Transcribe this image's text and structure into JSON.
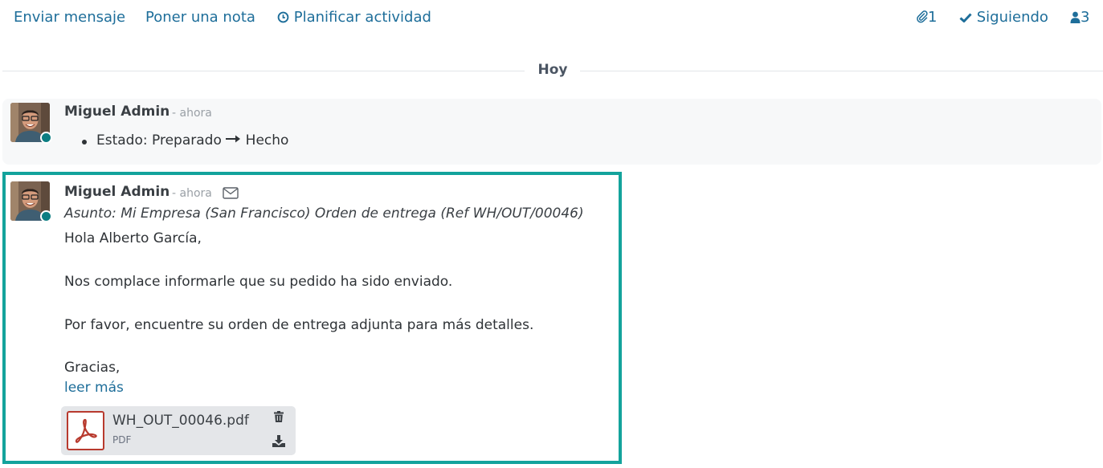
{
  "toolbar": {
    "send_message": "Enviar mensaje",
    "log_note": "Poner una nota",
    "schedule_activity": "Planificar actividad",
    "attachments_count": "1",
    "following": "Siguiendo",
    "followers_count": "3"
  },
  "separator": {
    "label": "Hoy"
  },
  "messages": [
    {
      "author": "Miguel Admin",
      "time": "- ahora",
      "tracking": {
        "field": "Estado:",
        "old": "Preparado",
        "new": "Hecho"
      }
    },
    {
      "author": "Miguel Admin",
      "time": "- ahora",
      "subject": "Asunto: Mi Empresa (San Francisco) Orden de entrega (Ref WH/OUT/00046)",
      "body": [
        "Hola Alberto García,",
        "Nos complace informarle que su pedido ha sido enviado.",
        "Por favor, encuentre su orden de entrega adjunta para más detalles.",
        "Gracias,"
      ],
      "read_more": "leer más",
      "attachment": {
        "name": "WH_OUT_00046.pdf",
        "type": "PDF"
      }
    }
  ],
  "icons": {
    "clock": "clock-icon",
    "paperclip": "paperclip-icon",
    "check": "check-icon",
    "user": "user-icon",
    "envelope": "envelope-icon",
    "arrow": "arrow-right-icon",
    "pdf": "pdf-icon",
    "trash": "trash-icon",
    "download": "download-icon"
  },
  "colors": {
    "link": "#1e6e9a",
    "highlight_border": "#13a39c",
    "online_status": "#0b7d82",
    "pdf_red": "#b83a2e"
  }
}
